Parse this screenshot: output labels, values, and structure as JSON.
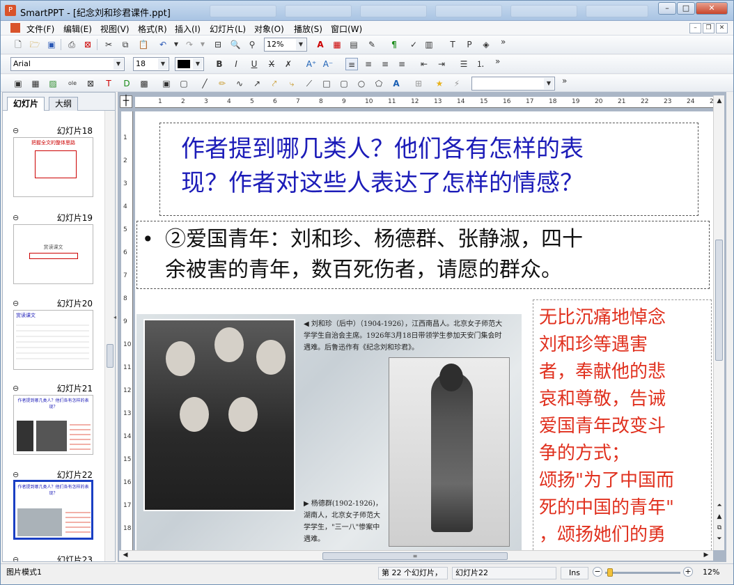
{
  "app": {
    "name": "SmartPPT",
    "title": "SmartPPT - [纪念刘和珍君课件.ppt]",
    "icon": "P"
  },
  "window_buttons": {
    "minimize": "–",
    "maximize": "□",
    "close": "✕"
  },
  "menu": {
    "items": [
      "文件(F)",
      "编辑(E)",
      "视图(V)",
      "格式(R)",
      "插入(I)",
      "幻灯片(L)",
      "对象(O)",
      "播放(S)",
      "窗口(W)"
    ]
  },
  "toolbar": {
    "zoom": "12%",
    "font": "Arial",
    "size": "18",
    "chevron": "»"
  },
  "panel": {
    "tabs": [
      "幻灯片",
      "大纲"
    ]
  },
  "thumbnails": [
    {
      "label": "幻灯片18",
      "title": "把握全文的整体思路"
    },
    {
      "label": "幻灯片19",
      "title": "赏读课文"
    },
    {
      "label": "幻灯片20",
      "title": "赏读课文"
    },
    {
      "label": "幻灯片21",
      "title": "作者提到哪几类人？他们各有怎样的表现？"
    },
    {
      "label": "幻灯片22",
      "title": "作者提到哪几类人？他们各有怎样的表现？"
    },
    {
      "label": "幻灯片23",
      "title": ""
    }
  ],
  "ruler": {
    "h": [
      "1",
      "2",
      "3",
      "4",
      "5",
      "6",
      "7",
      "8",
      "9",
      "10",
      "11",
      "12",
      "13",
      "14",
      "15",
      "16",
      "17",
      "18",
      "19",
      "20",
      "21",
      "22",
      "23",
      "24",
      "25"
    ],
    "v": [
      "1",
      "2",
      "3",
      "4",
      "5",
      "6",
      "7",
      "8",
      "9",
      "10",
      "11",
      "12",
      "13",
      "14",
      "15",
      "16",
      "17",
      "18"
    ]
  },
  "slide": {
    "question_line1": "作者提到哪几类人？他们各有怎样的表",
    "question_line2": "现？作者对这些人表达了怎样的情感？",
    "bullet_line1": "②爱国青年：刘和珍、杨德群、张静淑，四十",
    "bullet_line2": "余被害的青年，数百死伤者，请愿的群众。",
    "caption1": "◀ 刘和珍（后中）（1904-1926），江西南昌人。北京女子师范大学学生自治会主席。1926年3月18日带领学生参加天安门集会时遇难。后鲁迅作有《纪念刘和珍君》。",
    "caption2": "▶ 杨德群(1902-1926)，湖南人，北京女子师范大学学生，\"三一八\"惨案中遇难。",
    "right_lines": [
      "无比沉痛地悼念",
      "刘和珍等遇害",
      "者，奉献他的悲",
      "哀和尊敬，告诫",
      "爱国青年改变斗",
      "争的方式；",
      "颂扬\"为了中国而",
      "死的中国的青年\"",
      "，颂扬她们的勇"
    ]
  },
  "status": {
    "mode": "图片模式1",
    "count": "第 22 个幻灯片，",
    "current": "幻灯片22",
    "ins": "Ins",
    "zoom": "12%"
  }
}
